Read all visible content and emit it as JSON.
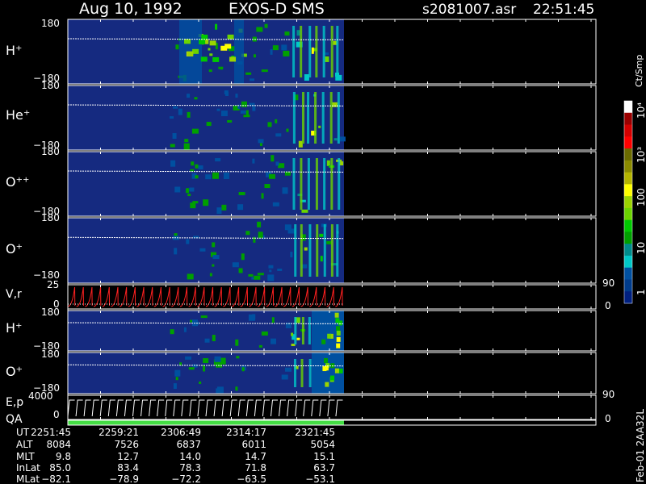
{
  "header": {
    "date": "Aug 10, 1992",
    "instrument": "EXOS-D SMS",
    "file": "s2081007.asr",
    "time": "22:51:45"
  },
  "colorbar": {
    "unit": "Ct/Smp",
    "tick_labels": [
      "10⁴",
      "10³",
      "100",
      "10",
      "1"
    ],
    "colors": [
      "#ffffff",
      "#9b0000",
      "#d40000",
      "#ff0000",
      "#6b6b00",
      "#8b8b00",
      "#b4b400",
      "#ffff00",
      "#9bd400",
      "#6bd400",
      "#00c800",
      "#00a000",
      "#008c8c",
      "#00c8c8",
      "#0050a0",
      "#003c8c",
      "#002080"
    ]
  },
  "panels": [
    {
      "id": "h-plus-1",
      "label": "H⁺",
      "ymax": "180",
      "ymin": "−180"
    },
    {
      "id": "he-plus",
      "label": "He⁺",
      "ymax": "180",
      "ymin": "−180"
    },
    {
      "id": "o-plus-plus",
      "label": "O⁺⁺",
      "ymax": "180",
      "ymin": "−180"
    },
    {
      "id": "o-plus-1",
      "label": "O⁺",
      "ymax": "180",
      "ymin": "−180"
    },
    {
      "id": "vr",
      "label": "V,r",
      "ymax": "25",
      "ymin": "0",
      "right_max": "90",
      "right_min": "0"
    },
    {
      "id": "h-plus-2",
      "label": "H⁺",
      "ymax": "180",
      "ymin": "−180"
    },
    {
      "id": "o-plus-2",
      "label": "O⁺",
      "ymax": "180",
      "ymin": "−180"
    },
    {
      "id": "ep",
      "label": "E,p",
      "ymax": "4000",
      "ymin": "0",
      "right_max": "90",
      "right_min": "0"
    },
    {
      "id": "qa",
      "label": "QA"
    }
  ],
  "orbit_table": {
    "labels": [
      "UT",
      "ALT",
      "MLT",
      "InLat",
      "MLat"
    ],
    "columns": [
      [
        "2251:45",
        "8084",
        "9.8",
        "85.0",
        "−82.1"
      ],
      [
        "2259:21",
        "7526",
        "12.7",
        "83.4",
        "−78.9"
      ],
      [
        "2306:49",
        "6837",
        "14.0",
        "78.3",
        "−72.2"
      ],
      [
        "2314:17",
        "6011",
        "14.7",
        "71.8",
        "−63.5"
      ],
      [
        "2321:45",
        "5054",
        "15.1",
        "63.7",
        "−53.1"
      ]
    ]
  },
  "footer": {
    "side_label": "Feb-01 2AA32L"
  },
  "chart_data": {
    "type": "heatmap",
    "title": "Aug 10, 1992   EXOS-D SMS",
    "x_ticks_ut": [
      "2251:45",
      "2259:21",
      "2306:49",
      "2314:17",
      "2321:45"
    ],
    "colorbar_range": [
      1,
      10000
    ],
    "colorbar_scale": "log",
    "data_extent_ut": [
      "2251:45",
      "2321:45"
    ],
    "panels": [
      "H⁺",
      "He⁺",
      "O⁺⁺",
      "O⁺",
      "V,r",
      "H⁺",
      "O⁺",
      "E,p",
      "QA"
    ]
  }
}
